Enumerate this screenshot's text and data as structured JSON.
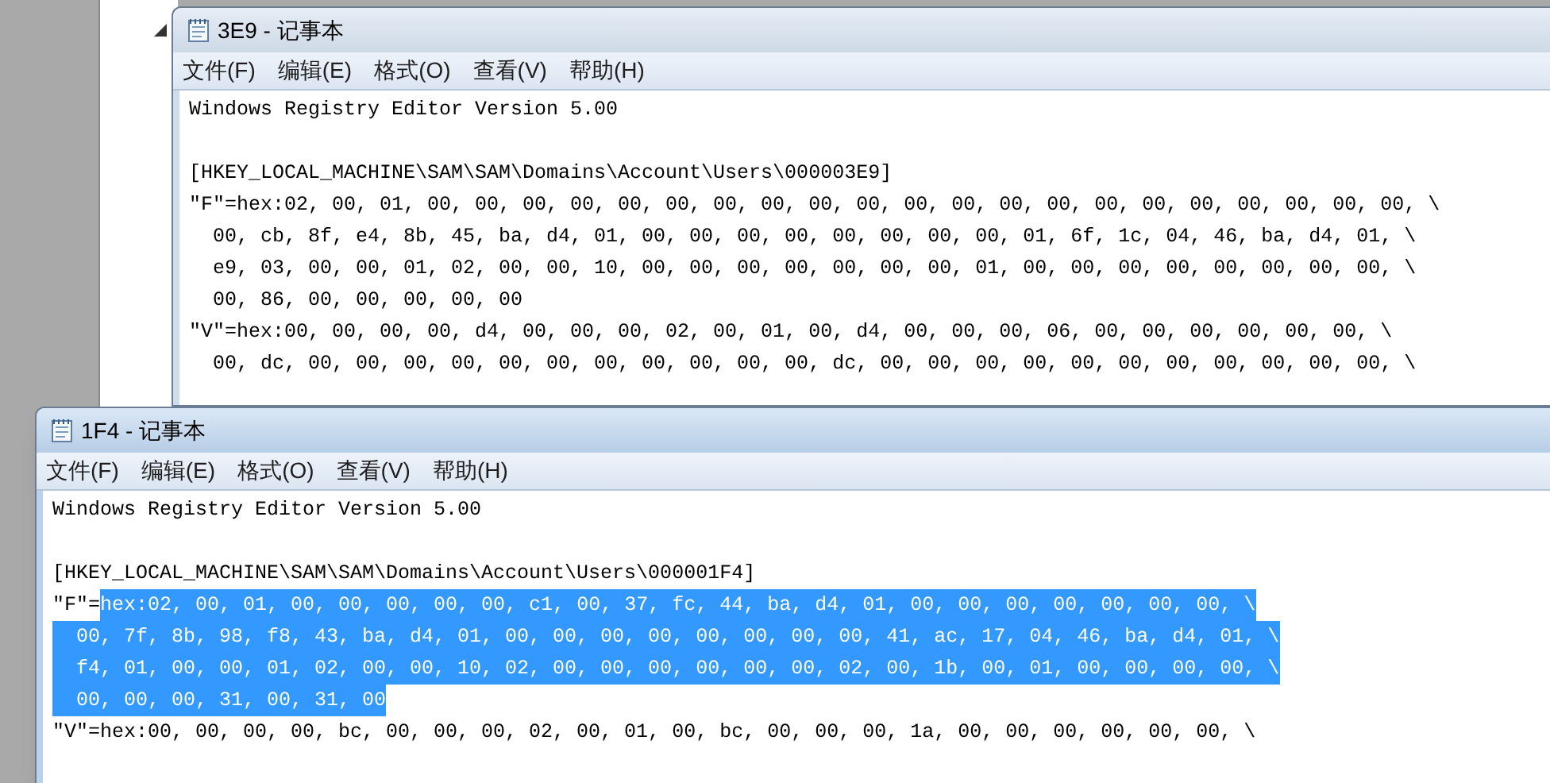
{
  "windows": [
    {
      "title": "3E9 - 记事本",
      "active": false,
      "menu": [
        "文件(F)",
        "编辑(E)",
        "格式(O)",
        "查看(V)",
        "帮助(H)"
      ],
      "paragraphs": [
        [
          [
            {
              "text": "Windows Registry Editor Version 5.00",
              "selected": false
            }
          ]
        ],
        [
          [
            {
              "text": "[HKEY_LOCAL_MACHINE\\SAM\\SAM\\Domains\\Account\\Users\\000003E9]",
              "selected": false
            }
          ],
          [
            {
              "text": "\"F\"=hex:02, 00, 01, 00, 00, 00, 00, 00, 00, 00, 00, 00, 00, 00, 00, 00, 00, 00, 00, 00, 00, 00, 00, 00, \\",
              "selected": false
            }
          ],
          [
            {
              "text": "  00, cb, 8f, e4, 8b, 45, ba, d4, 01, 00, 00, 00, 00, 00, 00, 00, 00, 01, 6f, 1c, 04, 46, ba, d4, 01, \\",
              "selected": false
            }
          ],
          [
            {
              "text": "  e9, 03, 00, 00, 01, 02, 00, 00, 10, 00, 00, 00, 00, 00, 00, 00, 01, 00, 00, 00, 00, 00, 00, 00, 00, \\",
              "selected": false
            }
          ],
          [
            {
              "text": "  00, 86, 00, 00, 00, 00, 00",
              "selected": false
            }
          ],
          [
            {
              "text": "\"V\"=hex:00, 00, 00, 00, d4, 00, 00, 00, 02, 00, 01, 00, d4, 00, 00, 00, 06, 00, 00, 00, 00, 00, 00, \\",
              "selected": false
            }
          ],
          [
            {
              "text": "  00, dc, 00, 00, 00, 00, 00, 00, 00, 00, 00, 00, 00, dc, 00, 00, 00, 00, 00, 00, 00, 00, 00, 00, 00, \\",
              "selected": false
            }
          ]
        ]
      ]
    },
    {
      "title": "1F4 - 记事本",
      "active": true,
      "menu": [
        "文件(F)",
        "编辑(E)",
        "格式(O)",
        "查看(V)",
        "帮助(H)"
      ],
      "paragraphs": [
        [
          [
            {
              "text": "Windows Registry Editor Version 5.00",
              "selected": false
            }
          ]
        ],
        [
          [
            {
              "text": "[HKEY_LOCAL_MACHINE\\SAM\\SAM\\Domains\\Account\\Users\\000001F4]",
              "selected": false
            }
          ],
          [
            {
              "text": "\"F\"=",
              "selected": false
            },
            {
              "text": "hex:02, 00, 01, 00, 00, 00, 00, 00, c1, 00, 37, fc, 44, ba, d4, 01, 00, 00, 00, 00, 00, 00, 00, \\",
              "selected": true
            }
          ],
          [
            {
              "text": "  00, 7f, 8b, 98, f8, 43, ba, d4, 01, 00, 00, 00, 00, 00, 00, 00, 00, 41, ac, 17, 04, 46, ba, d4, 01, \\",
              "selected": true
            }
          ],
          [
            {
              "text": "  f4, 01, 00, 00, 01, 02, 00, 00, 10, 02, 00, 00, 00, 00, 00, 00, 02, 00, 1b, 00, 01, 00, 00, 00, 00, \\",
              "selected": true
            }
          ],
          [
            {
              "text": "  00, 00, 00, 31, 00, 31, 00",
              "selected": true
            }
          ],
          [
            {
              "text": "\"V\"=hex:00, 00, 00, 00, bc, 00, 00, 00, 02, 00, 01, 00, bc, 00, 00, 00, 1a, 00, 00, 00, 00, 00, 00, \\",
              "selected": false
            }
          ]
        ]
      ]
    }
  ]
}
